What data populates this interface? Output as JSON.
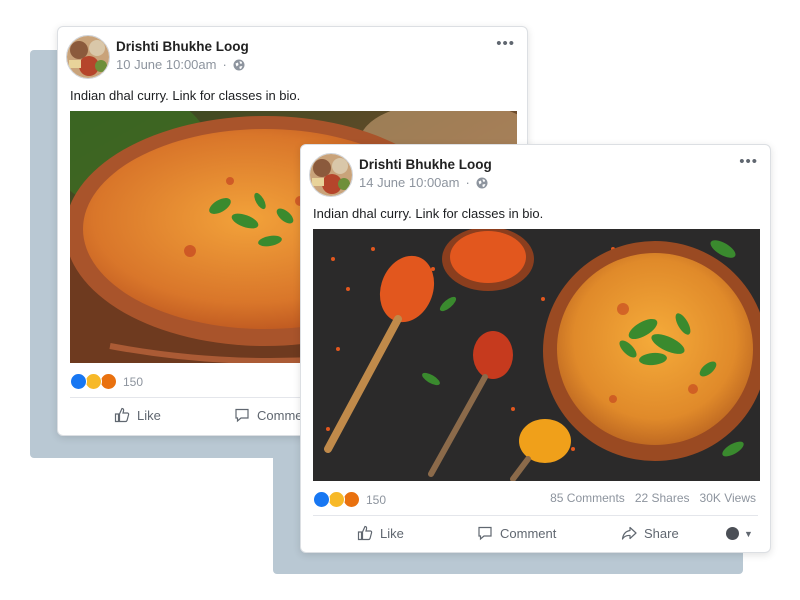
{
  "posts": [
    {
      "author": "Drishti Bhukhe Loog",
      "date": "10 June 10:00am",
      "separator": "·",
      "caption": "Indian dhal curry. Link for classes in bio.",
      "reaction_count": "150",
      "actions": {
        "like": "Like",
        "comment": "Comme"
      }
    },
    {
      "author": "Drishti Bhukhe Loog",
      "date": "14 June 10:00am",
      "separator": "·",
      "caption": "Indian dhal curry. Link for classes in bio.",
      "reaction_count": "150",
      "stats": {
        "comments": "85 Comments",
        "shares": "22 Shares",
        "views": "30K Views"
      },
      "actions": {
        "like": "Like",
        "comment": "Comment",
        "share": "Share"
      }
    }
  ],
  "more_label": "•••",
  "caret": "▼",
  "icons": {
    "avatar": "avatar-food-photo",
    "audience": "globe-icon",
    "like": "thumbs-up-icon",
    "comment": "comment-bubble-icon",
    "share": "share-arrow-icon"
  },
  "colors": {
    "panel": "#b9c8d3",
    "like_blue": "#1877f2",
    "haha_yellow": "#f7b928",
    "angry_orange": "#e9710f",
    "muted_text": "#8d949e",
    "dhal_orange": "#e8892a",
    "bowl_brown": "#a9542b",
    "herb_green": "#3a8a2e",
    "table_dark": "#2b2a2a"
  }
}
